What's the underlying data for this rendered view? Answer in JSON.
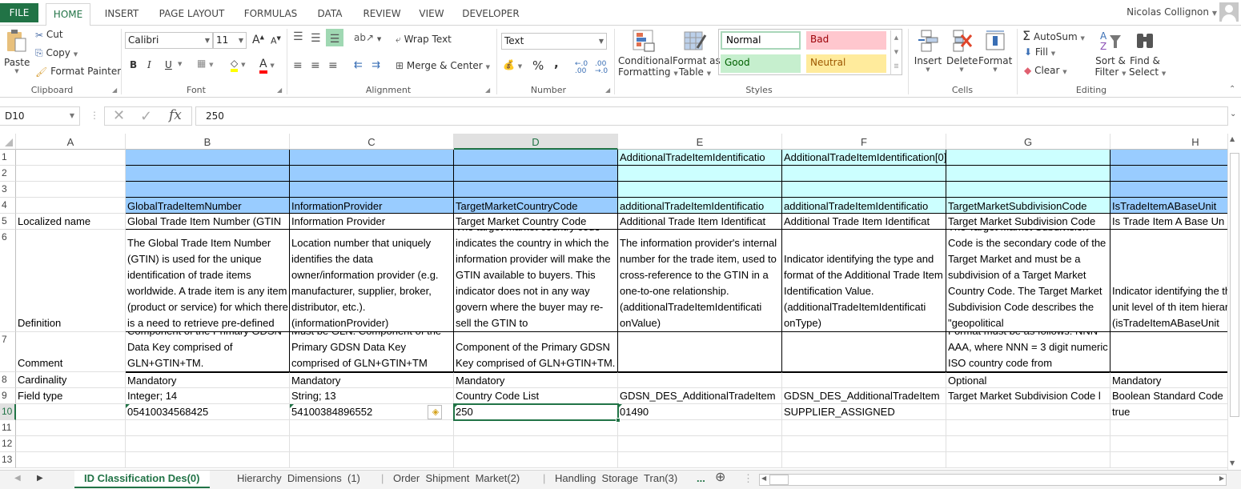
{
  "ribbon_tabs": [
    "FILE",
    "HOME",
    "INSERT",
    "PAGE LAYOUT",
    "FORMULAS",
    "DATA",
    "REVIEW",
    "VIEW",
    "DEVELOPER"
  ],
  "active_tab": "HOME",
  "user": {
    "name": "Nicolas Collignon"
  },
  "clipboard": {
    "paste": "Paste",
    "cut": "Cut",
    "copy": "Copy",
    "format_painter": "Format Painter",
    "label": "Clipboard"
  },
  "font": {
    "name": "Calibri",
    "size": "11",
    "bold": "B",
    "italic": "I",
    "underline": "U",
    "label": "Font"
  },
  "alignment": {
    "wrap_text": "Wrap Text",
    "merge_center": "Merge & Center",
    "label": "Alignment"
  },
  "number": {
    "format": "Text",
    "percent": "%",
    "comma": ",",
    "inc_decimal": "←.0 .00",
    "dec_decimal": ".00 →.0",
    "label": "Number"
  },
  "styles": {
    "conditional": "Conditional",
    "conditional2": "Formatting",
    "format_table": "Format as",
    "format_table2": "Table",
    "normal": "Normal",
    "bad": "Bad",
    "good": "Good",
    "neutral": "Neutral",
    "label": "Styles"
  },
  "cells": {
    "insert": "Insert",
    "delete": "Delete",
    "format": "Format",
    "label": "Cells"
  },
  "editing": {
    "autosum": "AutoSum",
    "fill": "Fill",
    "clear": "Clear",
    "sort": "Sort &",
    "sort2": "Filter",
    "find": "Find &",
    "find2": "Select",
    "label": "Editing"
  },
  "formula_bar": {
    "name_box": "D10",
    "fx": "fx",
    "value": "250"
  },
  "columns": [
    "A",
    "B",
    "C",
    "D",
    "E",
    "F",
    "G",
    "H"
  ],
  "selected_column": "D",
  "rows": [
    "1",
    "2",
    "3",
    "4",
    "5",
    "6",
    "7",
    "8",
    "9",
    "10",
    "11",
    "12",
    "13"
  ],
  "selected_row": "10",
  "grid": {
    "r1": {
      "E": "AdditionalTradeItemIdentificatio",
      "F": "AdditionalTradeItemIdentification[0]"
    },
    "r4": {
      "B": "GlobalTradeItemNumber",
      "C": "InformationProvider",
      "D": "TargetMarketCountryCode",
      "E": "additionalTradeItemIdentificatio",
      "F": "additionalTradeItemIdentificatio",
      "G": "TargetMarketSubdivisionCode",
      "H": "IsTradeItemABaseUnit"
    },
    "r5": {
      "A": "Localized name",
      "B": "Global Trade Item Number (GTIN",
      "C": "Information Provider",
      "D": "Target Market Country Code",
      "E": "Additional Trade Item Identificat",
      "F": "Additional Trade Item Identificat",
      "G": "Target Market Subdivision Code",
      "H": "Is Trade Item A Base Un"
    },
    "r6": {
      "A": "Definition",
      "B": "The Global Trade Item Number (GTIN) is used for the unique identification of trade items worldwide. A trade item is any item (product or service) for which there is a need to retrieve pre-defined",
      "C": "Location number that uniquely identifies the data owner/information provider (e.g. manufacturer, supplier, broker, distributor, etc.). (informationProvider)",
      "D": "The target market country code indicates the country in which the information provider will make the GTIN available to buyers. This indicator does not in any way govern where the buyer may re-sell the GTIN to",
      "E": "The information provider's internal number for the trade item, used to cross-reference to the GTIN in a one-to-one relationship. (additionalTradeItemIdentificati onValue)",
      "F": "Indicator identifying the type and format of the Additional Trade Item Identification Value. (additionalTradeItemIdentificati onType)",
      "G": "The Target Market Subdivision Code is the secondary code of the Target Market and must be a subdivision of a Target Market Country Code. The Target Market Subdivision Code describes the \"geopolitical",
      "H": "Indicator identifying the the base unit level of th item hierarchy. (isTradeItemABaseUnit"
    },
    "r7": {
      "A": "Comment",
      "B": "Component of the Primary GDSN Data Key comprised of GLN+GTIN+TM.",
      "C": "Must be GLN. Component of the Primary GDSN Data Key comprised of GLN+GTIN+TM",
      "D": "Component of the Primary GDSN Key comprised of GLN+GTIN+TM.",
      "G": "Format must be as follows: NNN-AAA, where NNN = 3 digit numeric ISO country code from"
    },
    "r8": {
      "A": "Cardinality",
      "B": "Mandatory",
      "C": "Mandatory",
      "D": "Mandatory",
      "G": "Optional",
      "H": "Mandatory"
    },
    "r9": {
      "A": "Field type",
      "B": "Integer; 14",
      "C": "String; 13",
      "D": "Country Code List",
      "E": "GDSN_DES_AdditionalTradeItem",
      "F": "GDSN_DES_AdditionalTradeItem",
      "G": "Target Market Subdivision Code l",
      "H": "Boolean Standard Code"
    },
    "r10": {
      "B": "05410034568425",
      "C": "54100384896552",
      "D": "250",
      "E": "01490",
      "F": "SUPPLIER_ASSIGNED",
      "H": "true"
    }
  },
  "sheet_tabs": [
    "ID  Classification  Des(0)",
    "Hierarchy  Dimensions  (1)",
    "Order  Shipment  Market(2)",
    "Handling  Storage  Tran(3)"
  ],
  "active_sheet": "ID  Classification  Des(0)",
  "more_sheets": "...",
  "colors": {
    "accent": "#217346",
    "header_blue": "#99ccff",
    "header_cyan": "#ccffff",
    "bad_bg": "#ffc7ce",
    "good_bg": "#c6efce",
    "neutral_bg": "#ffeb9c"
  }
}
